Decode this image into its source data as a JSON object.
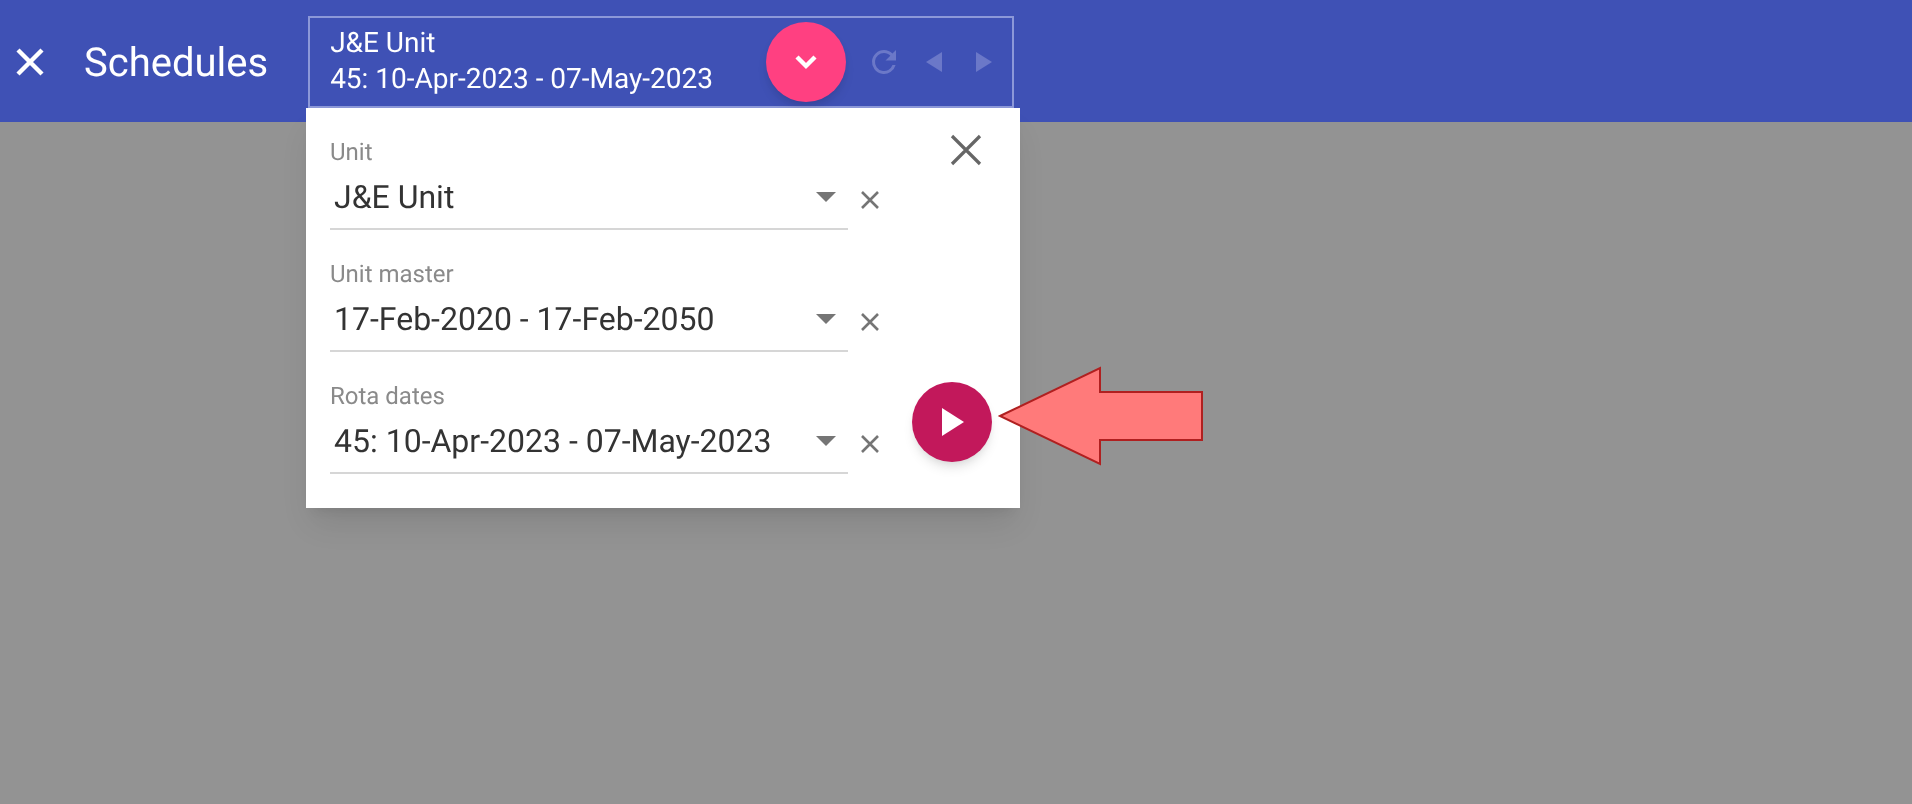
{
  "toolbar": {
    "title": "Schedules",
    "selector": {
      "line_1": "J&E Unit",
      "line_2": "45: 10-Apr-2023 - 07-May-2023"
    }
  },
  "popup": {
    "fields": [
      {
        "label": "Unit",
        "value": "J&E Unit"
      },
      {
        "label": "Unit master",
        "value": "17-Feb-2020 - 17-Feb-2050"
      },
      {
        "label": "Rota dates",
        "value": "45: 10-Apr-2023 - 07-May-2023"
      }
    ]
  }
}
